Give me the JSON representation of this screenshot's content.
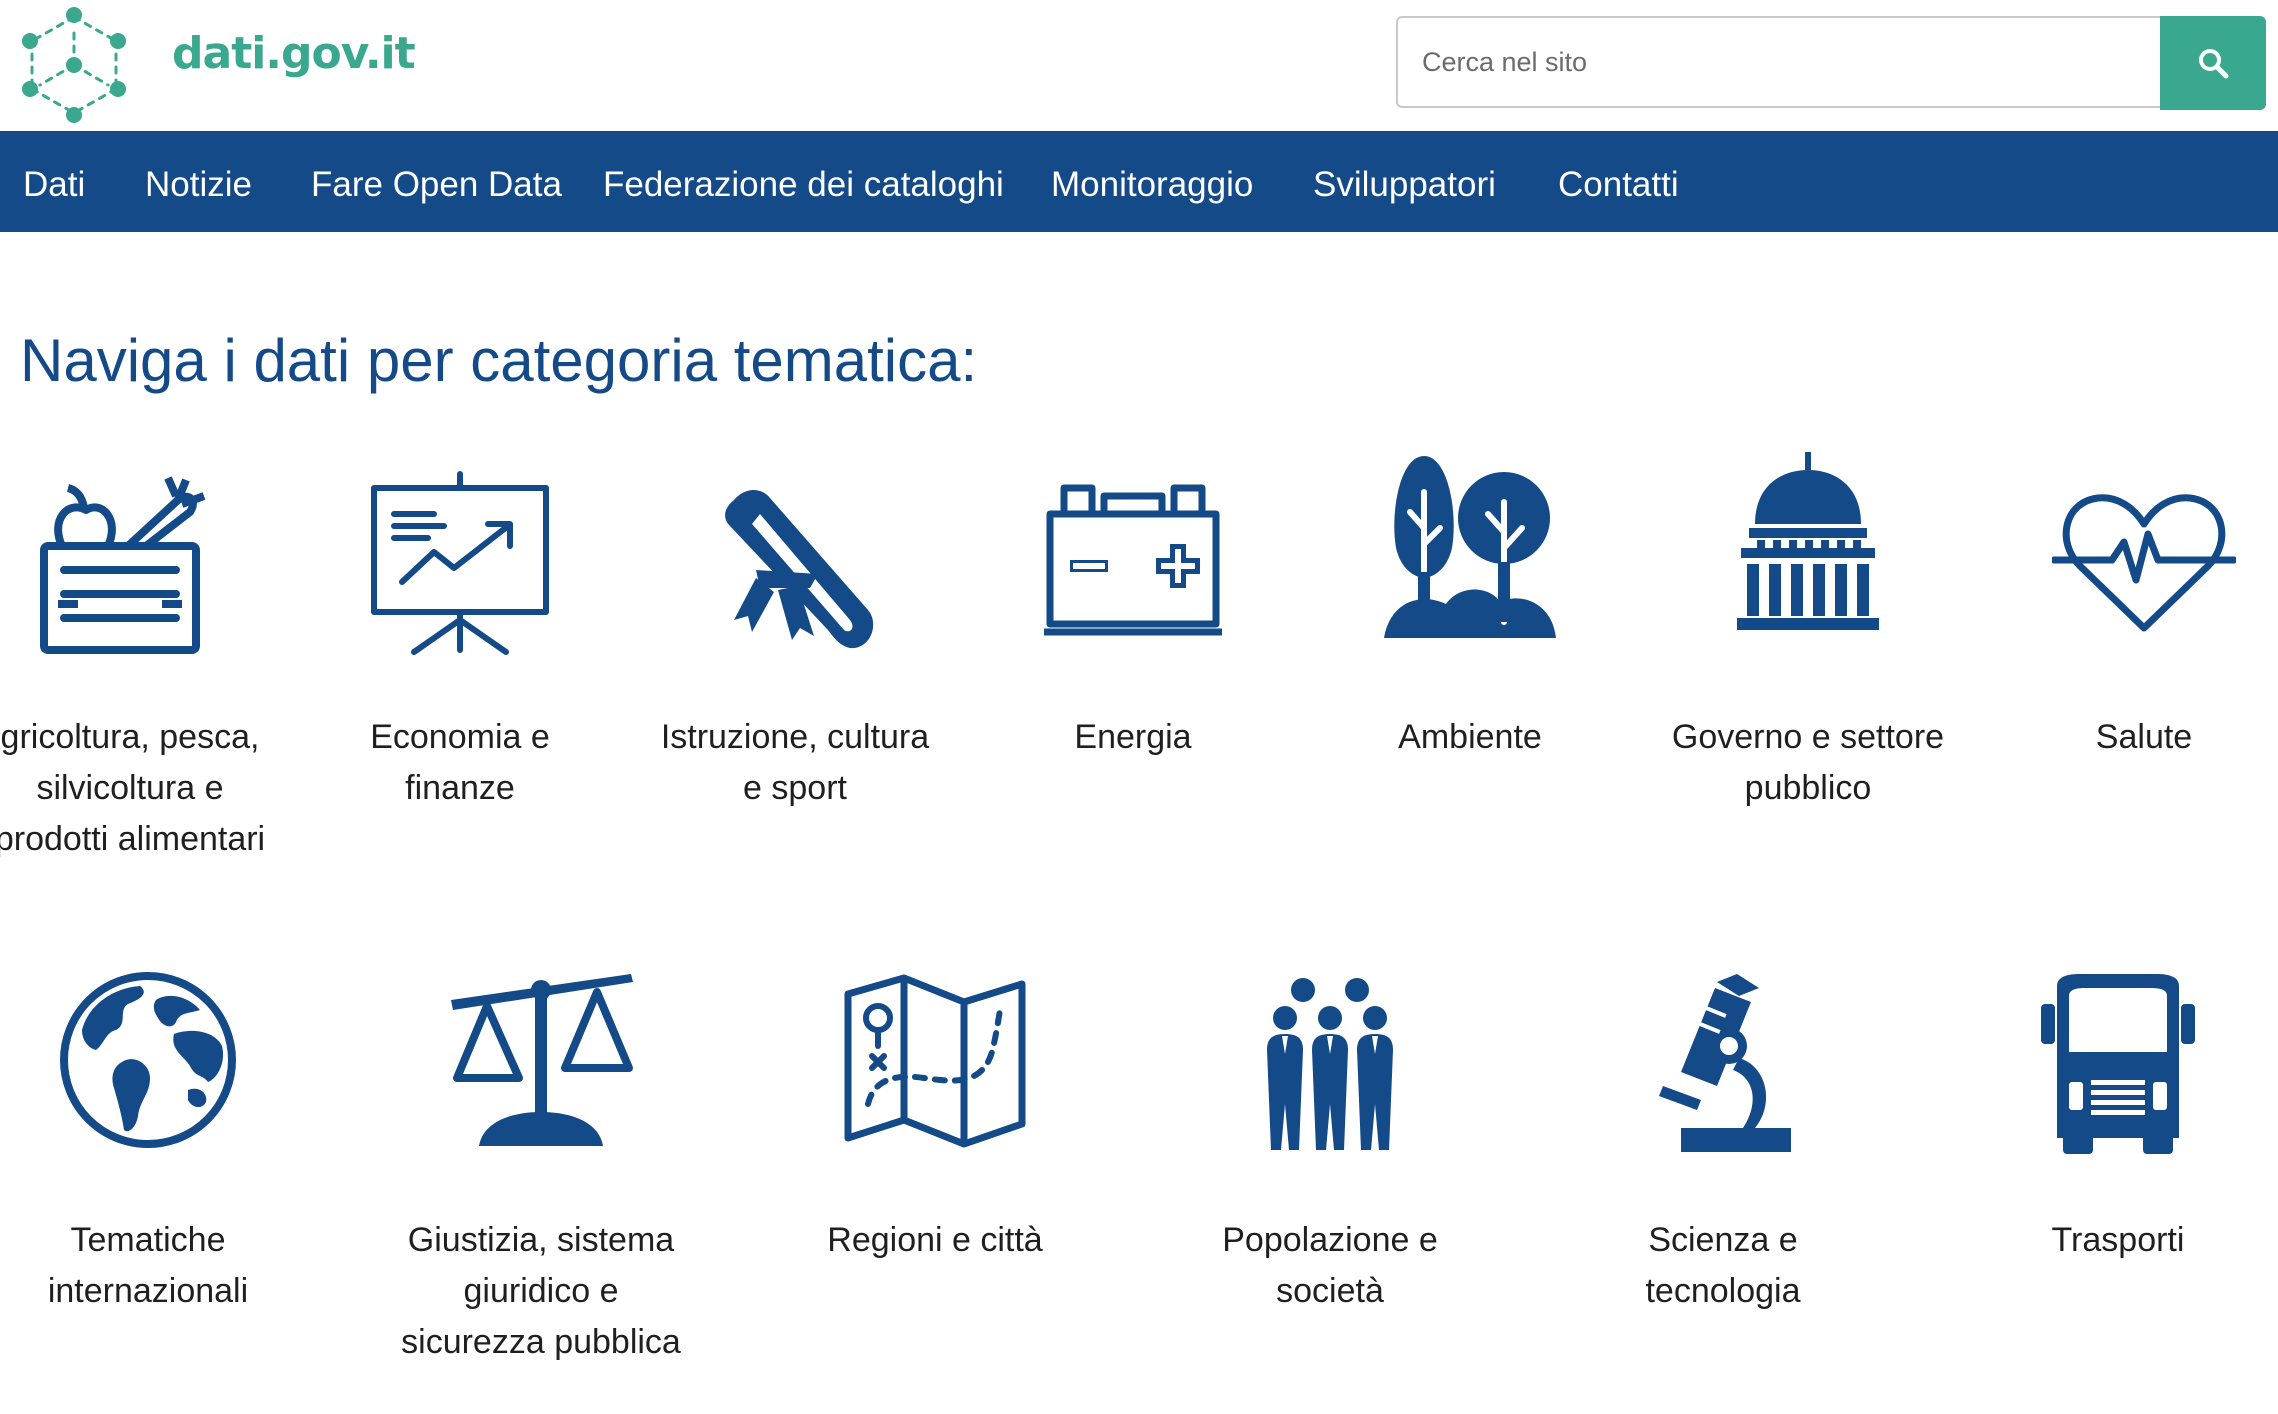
{
  "site": {
    "logo_text": "dati.gov.it"
  },
  "search": {
    "placeholder": "Cerca nel sito",
    "button_icon": "search-icon"
  },
  "nav": {
    "items": [
      {
        "label": "Dati"
      },
      {
        "label": "Notizie"
      },
      {
        "label": "Fare Open Data"
      },
      {
        "label": "Federazione dei cataloghi"
      },
      {
        "label": "Monitoraggio"
      },
      {
        "label": "Sviluppatori"
      },
      {
        "label": "Contatti"
      }
    ]
  },
  "main": {
    "heading": "Naviga i dati per categoria tematica:"
  },
  "categories": [
    {
      "icon": "agriculture-crate-icon",
      "label": "gricoltura, pesca, silvicoltura e prodotti alimentari"
    },
    {
      "icon": "presentation-chart-icon",
      "label": "Economia e finanze"
    },
    {
      "icon": "diploma-scroll-icon",
      "label": "Istruzione, cultura e sport"
    },
    {
      "icon": "battery-icon",
      "label": "Energia"
    },
    {
      "icon": "trees-icon",
      "label": "Ambiente"
    },
    {
      "icon": "capitol-building-icon",
      "label": "Governo e settore pubblico"
    },
    {
      "icon": "heartbeat-icon",
      "label": "Salute"
    },
    {
      "icon": "globe-icon",
      "label": "Tematiche internazionali"
    },
    {
      "icon": "scales-icon",
      "label": "Giustizia, sistema giuridico e sicurezza pubblica"
    },
    {
      "icon": "map-icon",
      "label": "Regioni e città"
    },
    {
      "icon": "people-group-icon",
      "label": "Popolazione e società"
    },
    {
      "icon": "microscope-icon",
      "label": "Scienza e tecnologia"
    },
    {
      "icon": "truck-icon",
      "label": "Trasporti"
    }
  ],
  "colors": {
    "brand_green": "#3aa88f",
    "nav_blue": "#134a87",
    "icon_blue": "#134a87"
  }
}
